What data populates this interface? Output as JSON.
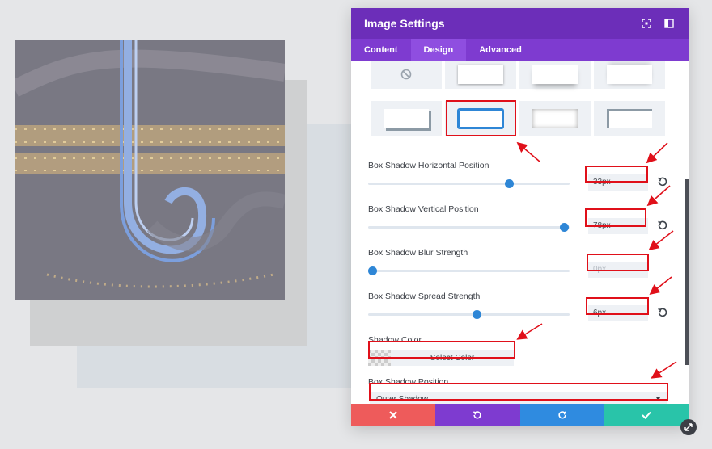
{
  "modal": {
    "title": "Image Settings",
    "tabs": [
      {
        "label": "Content",
        "active": false
      },
      {
        "label": "Design",
        "active": true
      },
      {
        "label": "Advanced",
        "active": false
      }
    ]
  },
  "fields": {
    "horizontal": {
      "label": "Box Shadow Horizontal Position",
      "value": "33px",
      "slider_fraction": 0.7
    },
    "vertical": {
      "label": "Box Shadow Vertical Position",
      "value": "78px",
      "slider_fraction": 0.97
    },
    "blur": {
      "label": "Box Shadow Blur Strength",
      "value": "0px",
      "slider_fraction": 0.02
    },
    "spread": {
      "label": "Box Shadow Spread Strength",
      "value": "6px",
      "slider_fraction": 0.54
    },
    "color": {
      "label": "Shadow Color",
      "button": "Select Color"
    },
    "position": {
      "label": "Box Shadow Position",
      "value": "Outer Shadow"
    }
  },
  "colors": {
    "header": "#6c2eb9",
    "tabs": "#7e3bd0",
    "accent": "#2e86d6",
    "cancel": "#ee5b5b",
    "undo": "#7e3bd0",
    "redo": "#2f8be0",
    "save": "#29c4a9",
    "annotation": "#e0101a"
  },
  "icons": {
    "header": [
      "expand-icon",
      "sidebar-toggle-icon"
    ],
    "footer": [
      "close-icon",
      "undo-icon",
      "redo-icon",
      "check-icon"
    ],
    "corner": "resize-icon"
  }
}
